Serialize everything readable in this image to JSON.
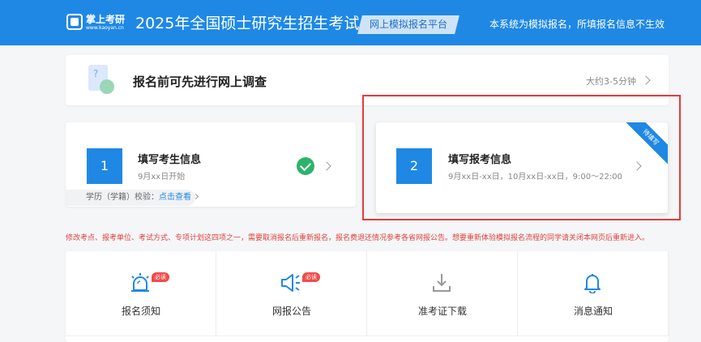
{
  "header": {
    "logo_name": "掌上考研",
    "logo_url": "www.kaoyan.cn",
    "title": "2025年全国硕士研究生招生考试",
    "platform_tag": "网上模拟报名平台",
    "note": "本系统为模拟报名，所填报名信息不生效"
  },
  "survey": {
    "title": "报名前可先进行网上调查",
    "time": "大约3-5分钟"
  },
  "steps": [
    {
      "number": "1",
      "title": "填写考生信息",
      "subtitle": "9月xx日开始",
      "status": "completed",
      "verify_label": "学历（学籍）校验：",
      "verify_link": "点击查看"
    },
    {
      "number": "2",
      "title": "填写报考信息",
      "subtitle": "9月xx日-xx日，10月xx日-xx日，9:00～22:00",
      "ribbon": "待填写"
    }
  ],
  "notice": "修改考点、报考单位、考试方式、专项计划这四项之一，需要取消报名后重新报名，报名费退还情况参考各省网报公告。想要重新体验模拟报名流程的同学请关闭本网页后重新进入。",
  "shortcuts": [
    {
      "label": "报名须知",
      "icon": "alarm-icon",
      "badge": "必读"
    },
    {
      "label": "网报公告",
      "icon": "megaphone-icon",
      "badge": "必读"
    },
    {
      "label": "准考证下载",
      "icon": "download-icon",
      "badge": ""
    },
    {
      "label": "消息通知",
      "icon": "bell-icon",
      "badge": ""
    }
  ],
  "colors": {
    "primary": "#1f88e5",
    "success": "#2db36b",
    "alert": "#e0413a",
    "highlight_border": "#e83a3a"
  }
}
